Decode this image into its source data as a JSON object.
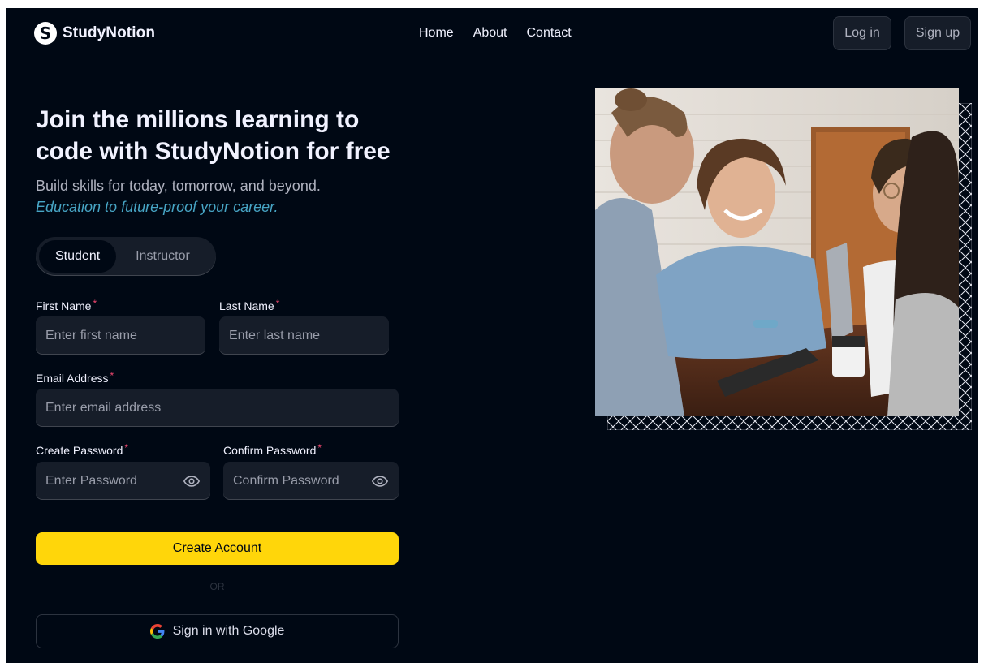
{
  "brand": {
    "name": "StudyNotion",
    "mark": "S"
  },
  "nav": {
    "links": [
      "Home",
      "About",
      "Contact"
    ],
    "login_label": "Log in",
    "signup_label": "Sign up"
  },
  "hero": {
    "heading": "Join the millions learning to code with StudyNotion for free",
    "subtitle": "Build skills for today, tomorrow, and beyond.",
    "tagline": "Education to future-proof your career."
  },
  "role_toggle": {
    "options": [
      "Student",
      "Instructor"
    ],
    "selected": "Student"
  },
  "form": {
    "first_name": {
      "label": "First Name",
      "placeholder": "Enter first name"
    },
    "last_name": {
      "label": "Last Name",
      "placeholder": "Enter last name"
    },
    "email": {
      "label": "Email Address",
      "placeholder": "Enter email address"
    },
    "password": {
      "label": "Create Password",
      "placeholder": "Enter Password"
    },
    "confirm_password": {
      "label": "Confirm Password",
      "placeholder": "Confirm Password"
    },
    "required_marker": "*",
    "submit_label": "Create Account",
    "divider_label": "OR",
    "google_label": "Sign in with Google"
  },
  "colors": {
    "background": "#000814",
    "accent": "#ffd60a",
    "tagline": "#47a5c5",
    "required": "#ef476f",
    "field": "#161d29"
  },
  "icons": [
    "eye-icon",
    "google-icon",
    "logo-icon"
  ]
}
